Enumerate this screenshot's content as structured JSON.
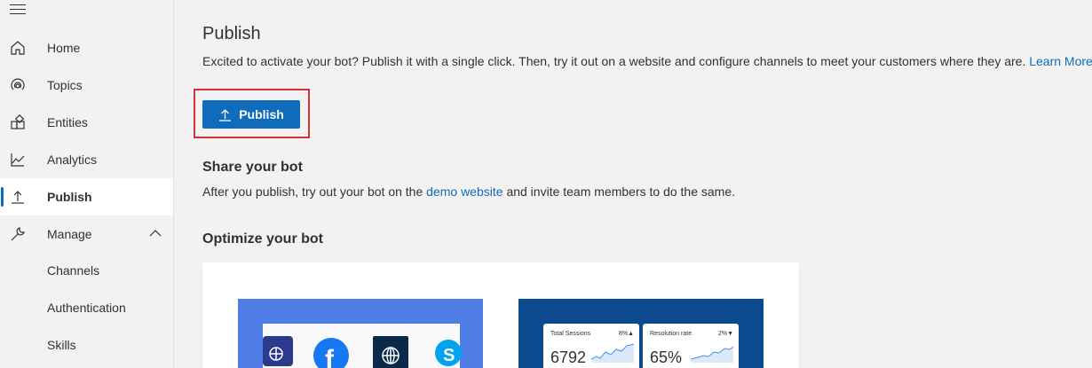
{
  "sidebar": {
    "items": [
      {
        "label": "Home",
        "icon": "home-icon"
      },
      {
        "label": "Topics",
        "icon": "topics-icon"
      },
      {
        "label": "Entities",
        "icon": "entities-icon"
      },
      {
        "label": "Analytics",
        "icon": "analytics-icon"
      },
      {
        "label": "Publish",
        "icon": "publish-icon",
        "active": true
      },
      {
        "label": "Manage",
        "icon": "wrench-icon",
        "expanded": true
      }
    ],
    "subitems": [
      {
        "label": "Channels"
      },
      {
        "label": "Authentication"
      },
      {
        "label": "Skills"
      }
    ]
  },
  "main": {
    "title": "Publish",
    "description": "Excited to activate your bot? Publish it with a single click. Then, try it out on a website and configure channels to meet your customers where they are.",
    "learn_more": "Learn More",
    "publish_button": "Publish",
    "share_title": "Share your bot",
    "share_desc_before": "After you publish, try out your bot on the",
    "share_link": "demo website",
    "share_desc_after": "and invite team members to do the same.",
    "optimize_title": "Optimize your bot",
    "stats": [
      {
        "caption": "Total Sessions",
        "delta": "8%▲",
        "value": "6792"
      },
      {
        "caption": "Resolution rate",
        "delta": "2%▼",
        "value": "65%"
      }
    ]
  },
  "colors": {
    "accent": "#0f6cbd",
    "highlight": "#d13438",
    "sidebar_bg": "#f3f2f1"
  }
}
